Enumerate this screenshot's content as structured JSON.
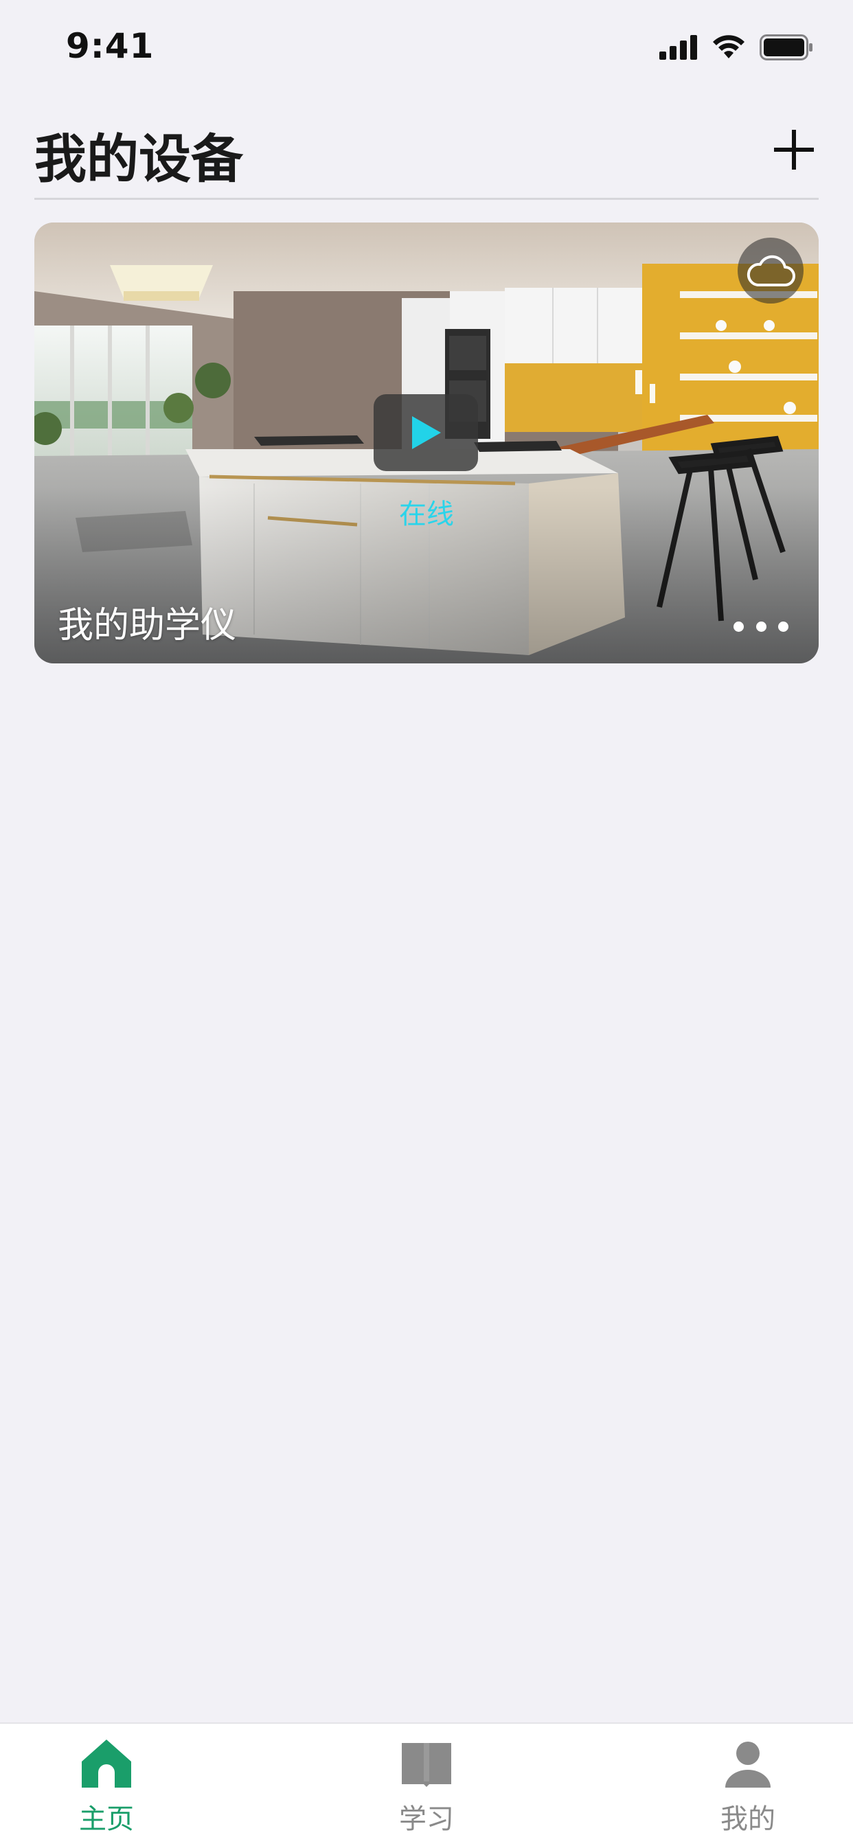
{
  "status_bar": {
    "time": "9:41",
    "icons": [
      "signal-icon",
      "wifi-icon",
      "battery-icon"
    ]
  },
  "header": {
    "title": "我的设备",
    "add_icon": "plus-icon"
  },
  "device_card": {
    "name": "我的助学仪",
    "status": "在线",
    "icons": {
      "cloud": "cloud-icon",
      "play": "play-icon",
      "more": "more-icon"
    },
    "status_color": "#2ad4ea"
  },
  "tab_bar": {
    "tabs": [
      {
        "label": "主页",
        "icon": "home-icon",
        "active": true
      },
      {
        "label": "学习",
        "icon": "book-icon",
        "active": false
      },
      {
        "label": "我的",
        "icon": "person-icon",
        "active": false
      }
    ],
    "active_color": "#1a9e6a",
    "inactive_color": "#8a8a8a"
  }
}
